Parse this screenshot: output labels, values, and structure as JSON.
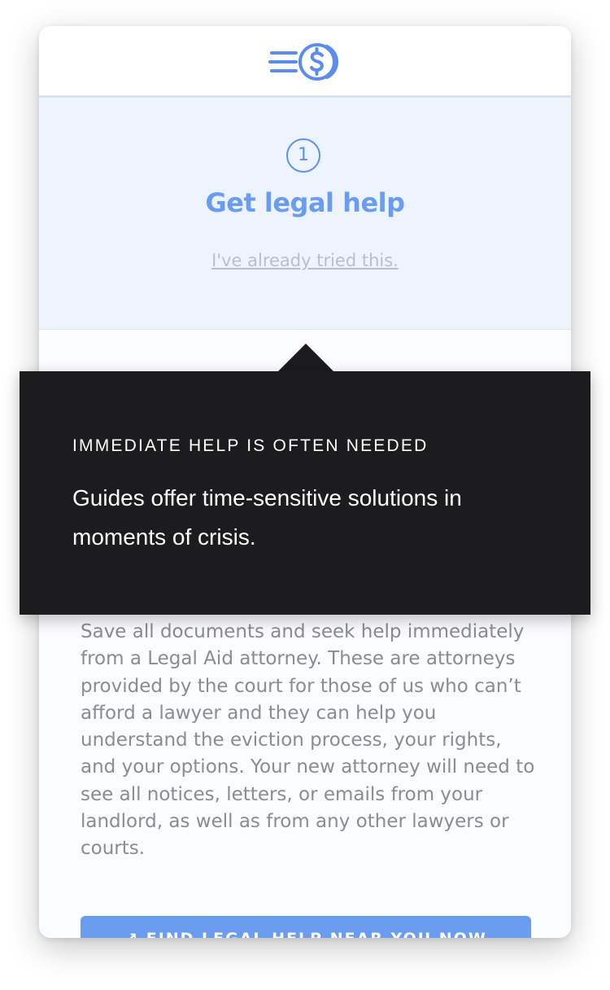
{
  "header": {
    "logo_icon": "menu-lines-dollar-coin-icon"
  },
  "step": {
    "number": "1",
    "title": "Get legal help",
    "skip_link": "I've already tried this."
  },
  "tooltip": {
    "heading": "IMMEDIATE HELP IS OFTEN NEEDED",
    "body": "Guides offer time-sensitive solutions in moments of crisis."
  },
  "content": {
    "paragraph": "Save all documents and seek help immediately from a Legal Aid attorney. These are attorneys provided by the court for those of us who can’t afford a lawyer and they can help you understand the eviction process, your rights, and your options. Your new attorney will need to see all notices, letters, or emails from your landlord, as well as from any other lawyers or courts.",
    "button_label": "↗ FIND LEGAL HELP NEAR YOU NOW"
  },
  "colors": {
    "accent": "#6a9df0",
    "tooltip_bg": "#1c1c1e",
    "step_bg": "#eef4fd"
  }
}
